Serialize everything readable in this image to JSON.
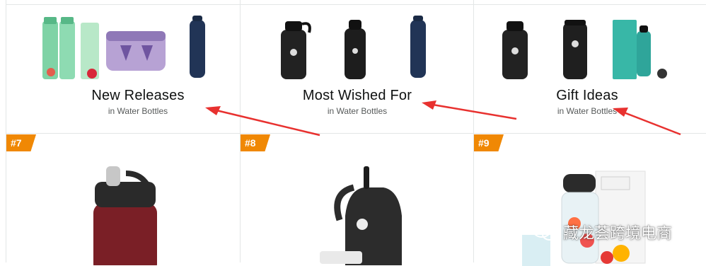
{
  "cards": [
    {
      "title": "New Releases",
      "subtitle": "in Water Bottles"
    },
    {
      "title": "Most Wished For",
      "subtitle": "in Water Bottles"
    },
    {
      "title": "Gift Ideas",
      "subtitle": "in Water Bottles"
    }
  ],
  "ranks": [
    "#7",
    "#8",
    "#9"
  ],
  "watermark": {
    "text": "藏龙荟跨境电商",
    "icon": "wechat-icon"
  },
  "colors": {
    "rank_badge": "#f08804",
    "arrow": "#e8312f",
    "title": "#0f1111",
    "subtitle": "#565959"
  }
}
